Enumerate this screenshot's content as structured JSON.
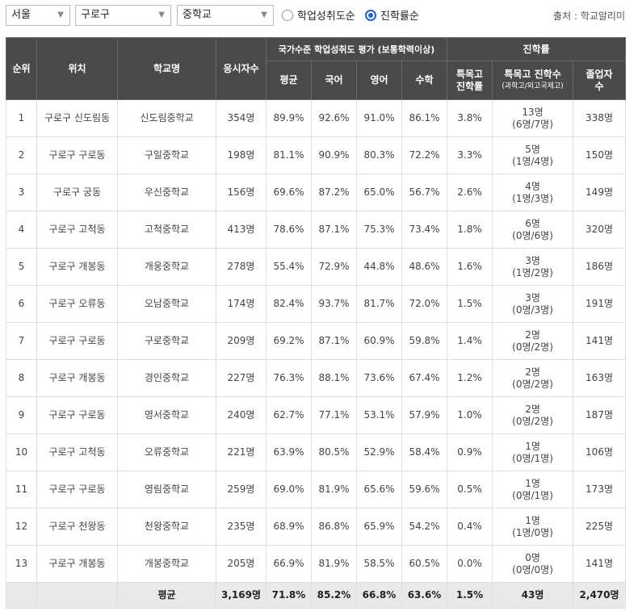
{
  "filters": {
    "region": "서울",
    "district": "구로구",
    "school_type": "중학교",
    "sort_options": [
      {
        "label": "학업성취도순",
        "selected": false
      },
      {
        "label": "진학률순",
        "selected": true
      }
    ],
    "source": "출처 : 학교알리미"
  },
  "table": {
    "headers": {
      "rank": "순위",
      "location": "위치",
      "school": "학교명",
      "test_takers": "응시자수",
      "achievement_group": "국가수준 학업성취도 평가 (보통학력이상)",
      "advancement_group": "진학률",
      "avg": "평균",
      "korean": "국어",
      "english": "영어",
      "math": "수학",
      "special_rate": "특목고 진학률",
      "special_count": "특목고 진학수",
      "special_count_sub": "(과학고/외고국제고)",
      "graduates": "졸업자 수"
    },
    "rows": [
      {
        "rank": "1",
        "location": "구로구 신도림동",
        "school": "신도림중학교",
        "takers": "354명",
        "avg": "89.9%",
        "korean": "92.6%",
        "english": "91.0%",
        "math": "86.1%",
        "rate": "3.8%",
        "count": "13명",
        "breakdown": "(6명/7명)",
        "graduates": "338명"
      },
      {
        "rank": "2",
        "location": "구로구 구로동",
        "school": "구일중학교",
        "takers": "198명",
        "avg": "81.1%",
        "korean": "90.9%",
        "english": "80.3%",
        "math": "72.2%",
        "rate": "3.3%",
        "count": "5명",
        "breakdown": "(1명/4명)",
        "graduates": "150명"
      },
      {
        "rank": "3",
        "location": "구로구 궁동",
        "school": "우신중학교",
        "takers": "156명",
        "avg": "69.6%",
        "korean": "87.2%",
        "english": "65.0%",
        "math": "56.7%",
        "rate": "2.6%",
        "count": "4명",
        "breakdown": "(1명/3명)",
        "graduates": "149명"
      },
      {
        "rank": "4",
        "location": "구로구 고척동",
        "school": "고척중학교",
        "takers": "413명",
        "avg": "78.6%",
        "korean": "87.1%",
        "english": "75.3%",
        "math": "73.4%",
        "rate": "1.8%",
        "count": "6명",
        "breakdown": "(0명/6명)",
        "graduates": "320명"
      },
      {
        "rank": "5",
        "location": "구로구 개봉동",
        "school": "개웅중학교",
        "takers": "278명",
        "avg": "55.4%",
        "korean": "72.9%",
        "english": "44.8%",
        "math": "48.6%",
        "rate": "1.6%",
        "count": "3명",
        "breakdown": "(1명/2명)",
        "graduates": "186명"
      },
      {
        "rank": "6",
        "location": "구로구 오류동",
        "school": "오남중학교",
        "takers": "174명",
        "avg": "82.4%",
        "korean": "93.7%",
        "english": "81.7%",
        "math": "72.0%",
        "rate": "1.5%",
        "count": "3명",
        "breakdown": "(0명/3명)",
        "graduates": "191명"
      },
      {
        "rank": "7",
        "location": "구로구 구로동",
        "school": "구로중학교",
        "takers": "209명",
        "avg": "69.2%",
        "korean": "87.1%",
        "english": "60.9%",
        "math": "59.8%",
        "rate": "1.4%",
        "count": "2명",
        "breakdown": "(0명/2명)",
        "graduates": "141명"
      },
      {
        "rank": "8",
        "location": "구로구 개봉동",
        "school": "경인중학교",
        "takers": "227명",
        "avg": "76.3%",
        "korean": "88.1%",
        "english": "73.6%",
        "math": "67.4%",
        "rate": "1.2%",
        "count": "2명",
        "breakdown": "(0명/2명)",
        "graduates": "163명"
      },
      {
        "rank": "9",
        "location": "구로구 구로동",
        "school": "영서중학교",
        "takers": "240명",
        "avg": "62.7%",
        "korean": "77.1%",
        "english": "53.1%",
        "math": "57.9%",
        "rate": "1.0%",
        "count": "2명",
        "breakdown": "(0명/2명)",
        "graduates": "187명"
      },
      {
        "rank": "10",
        "location": "구로구 고척동",
        "school": "오류중학교",
        "takers": "221명",
        "avg": "63.9%",
        "korean": "80.5%",
        "english": "52.9%",
        "math": "58.4%",
        "rate": "0.9%",
        "count": "1명",
        "breakdown": "(0명/1명)",
        "graduates": "106명"
      },
      {
        "rank": "11",
        "location": "구로구 구로동",
        "school": "영림중학교",
        "takers": "259명",
        "avg": "69.0%",
        "korean": "81.9%",
        "english": "65.6%",
        "math": "59.6%",
        "rate": "0.5%",
        "count": "1명",
        "breakdown": "(0명/1명)",
        "graduates": "173명"
      },
      {
        "rank": "12",
        "location": "구로구 천왕동",
        "school": "천왕중학교",
        "takers": "235명",
        "avg": "68.9%",
        "korean": "86.8%",
        "english": "65.9%",
        "math": "54.2%",
        "rate": "0.4%",
        "count": "1명",
        "breakdown": "(1명/0명)",
        "graduates": "225명"
      },
      {
        "rank": "13",
        "location": "구로구 개봉동",
        "school": "개봉중학교",
        "takers": "205명",
        "avg": "66.9%",
        "korean": "81.9%",
        "english": "58.5%",
        "math": "60.5%",
        "rate": "0.0%",
        "count": "0명",
        "breakdown": "(0명/0명)",
        "graduates": "141명"
      }
    ],
    "average": {
      "label": "평균",
      "takers": "3,169명",
      "avg": "71.8%",
      "korean": "85.2%",
      "english": "66.8%",
      "math": "63.6%",
      "rate": "1.5%",
      "count": "43명",
      "graduates": "2,470명"
    }
  },
  "colors": {
    "header_bg": "#4a4a4a",
    "accent": "#1a63d8",
    "avg_row_bg": "#e9e9e9"
  }
}
